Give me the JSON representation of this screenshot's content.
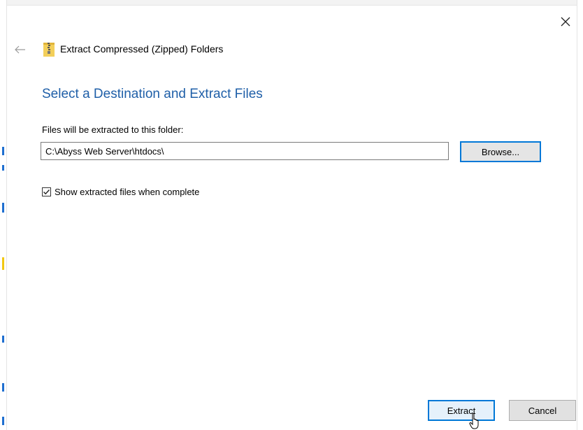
{
  "window": {
    "title": "Extract Compressed (Zipped) Folders",
    "icon": "zipped-folder-icon",
    "close_icon": "close-icon",
    "back_icon": "back-arrow-icon"
  },
  "main": {
    "heading": "Select a Destination and Extract Files",
    "destination_label": "Files will be extracted to this folder:",
    "destination_value": "C:\\Abyss Web Server\\htdocs\\",
    "browse_label": "Browse...",
    "show_files_checked": true,
    "show_files_label": "Show extracted files when complete"
  },
  "footer": {
    "extract_label": "Extract",
    "cancel_label": "Cancel"
  },
  "colors": {
    "heading": "#1f5fa8",
    "accent": "#0078d7"
  }
}
